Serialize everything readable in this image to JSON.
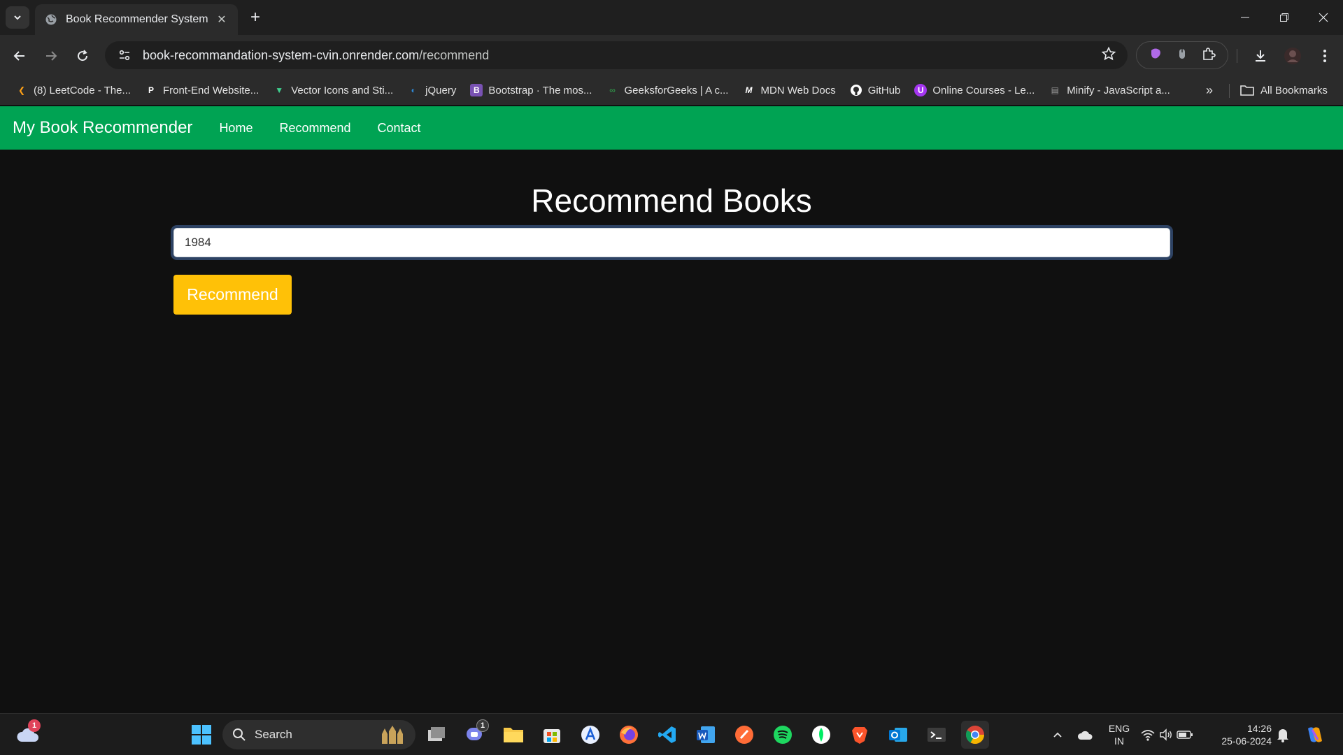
{
  "browser": {
    "tab_title": "Book Recommender System",
    "url_domain": "book-recommandation-system-cvin.onrender.com",
    "url_path": "/recommend",
    "bookmarks": [
      {
        "label": "(8) LeetCode - The...",
        "icon": "leetcode-icon",
        "color": "#ffa116"
      },
      {
        "label": "Front-End Website...",
        "icon": "frontend-icon",
        "color": "#ffffff"
      },
      {
        "label": "Vector Icons and Sti...",
        "icon": "vector-icon",
        "color": "#3fcf8e"
      },
      {
        "label": "jQuery",
        "icon": "jquery-icon",
        "color": "#2f8ad8"
      },
      {
        "label": "Bootstrap · The mos...",
        "icon": "bootstrap-icon",
        "color": "#7952b3"
      },
      {
        "label": "GeeksforGeeks | A c...",
        "icon": "gfg-icon",
        "color": "#2f8d46"
      },
      {
        "label": "MDN Web Docs",
        "icon": "mdn-icon",
        "color": "#ffffff"
      },
      {
        "label": "GitHub",
        "icon": "github-icon",
        "color": "#ffffff"
      },
      {
        "label": "Online Courses - Le...",
        "icon": "udemy-icon",
        "color": "#a435f0"
      },
      {
        "label": "Minify - JavaScript a...",
        "icon": "minify-icon",
        "color": "#999999"
      }
    ],
    "all_bookmarks_label": "All Bookmarks"
  },
  "page": {
    "brand": "My Book Recommender",
    "nav": [
      "Home",
      "Recommend",
      "Contact"
    ],
    "title": "Recommend Books",
    "input_value": "1984",
    "button_label": "Recommend",
    "navbar_color": "#00a353",
    "button_color": "#ffc107"
  },
  "taskbar": {
    "search_label": "Search",
    "weather_badge": "1",
    "teams_badge": "1",
    "lang_line1": "ENG",
    "lang_line2": "IN",
    "time": "14:26",
    "date": "25-06-2024"
  }
}
